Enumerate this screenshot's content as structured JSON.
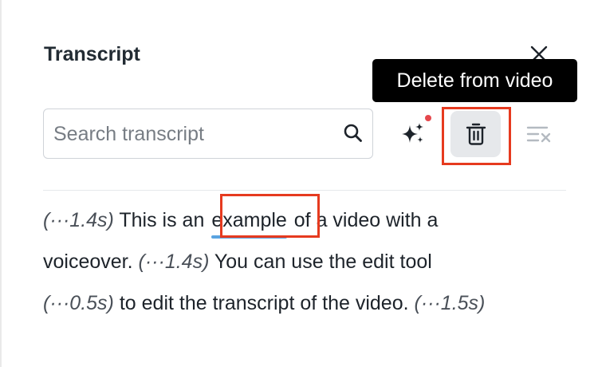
{
  "panel": {
    "title": "Transcript"
  },
  "tooltip": {
    "text": "Delete from video"
  },
  "search": {
    "placeholder": "Search transcript",
    "value": ""
  },
  "toolbar": {
    "ai_icon": "sparkles-icon",
    "delete_icon": "trash-icon",
    "clear_icon": "clear-list-icon",
    "close_icon": "close-icon"
  },
  "transcript": {
    "line1": {
      "pause1": "(···1.4s)",
      "text_before": " This is an ",
      "selected_word": "example",
      "text_after": " of a video with a"
    },
    "line2": {
      "text_before": "voiceover. ",
      "pause": "(···1.4s)",
      "text_after": " You can use the edit tool"
    },
    "line3": {
      "pause1": "(···0.5s)",
      "text": " to edit the transcript of the video. ",
      "pause2": "(···1.5s)"
    }
  },
  "colors": {
    "highlight_box": "#e63a1f",
    "selection_underline": "#5aa3e0",
    "notification_dot": "#e5484d",
    "tooltip_bg": "#000000"
  }
}
